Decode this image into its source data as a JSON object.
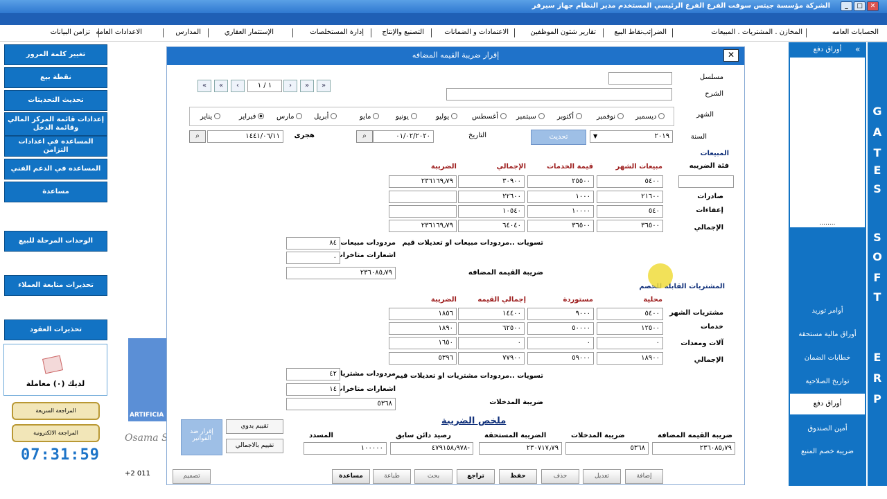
{
  "window": {
    "title": "الشركة مؤسسة جيتس سوفت   الفرع الفرع الرئيسي   المستخدم مدير النظام   جهاز سيرفر",
    "minimize": "_",
    "maximize": "□",
    "close": "✕"
  },
  "menu": [
    "الحسابات العامه",
    "المخازن . المشتريات . المبيعات",
    "الضرائب",
    "نقاط البيع",
    "تقارير شئون الموظفين",
    "الاعتمادات و الضمانات",
    "التصنيع والإنتاج",
    "إدارة المستخلصات",
    "الإستثمار العقاري",
    "المدارس",
    "الاعدادات العامه",
    "تزامن البيانات"
  ],
  "left_buttons": [
    "تغيير كلمة المرور",
    "نقطة بيع",
    "تحديث التحديثات",
    "إعدادات قائمة المركز المالي وقائمة الدخل",
    "المساعده في اعدادات التزامن",
    "المساعده في الدعم الفني",
    "مساعدة",
    "الوحدات المرحلة للبيع",
    "تحذيرات متابعة العملاء",
    "تحذيرات العقود"
  ],
  "notification": "لديك (٠) معاملة",
  "gold_buttons": [
    "المراجعة السريعة",
    "المراجعة الالكترونية"
  ],
  "clock": "07:31:59",
  "footer": {
    "phone": "+2 011",
    "company": "Osama S",
    "brand": "ARTIFICIA"
  },
  "dialog": {
    "title": "إقرار ضريبة القيمه المضافه",
    "close": "✕",
    "labels": {
      "serial": "مسلسل",
      "desc": "الشرح",
      "month": "الشهر",
      "year": "السنة",
      "date": "التاريخ",
      "hijri": "هجرى",
      "update": "تحديث",
      "category": "فئة الضريبه"
    },
    "values": {
      "year": "٢٠١٩",
      "date": "٠١/٠٢/٢٠٢٠",
      "hijri": "١٤٤١/٠٦/١١",
      "nav": "١ / ١"
    },
    "months": [
      "ديسمبر",
      "نوفمبر",
      "أكتوبر",
      "سبتمبر",
      "أغسطس",
      "يوليو",
      "يونيو",
      "مايو",
      "أبريل",
      "مارس",
      "فبراير",
      "يناير"
    ],
    "selected_month": "فبراير",
    "sales": {
      "title": "المبيعات",
      "headers": [
        "مبيعات الشهر",
        "قيمة الخدمات",
        "الإجمالي",
        "الضريبة"
      ],
      "row_labels": [
        "صادرات",
        "إعفاءات",
        "الإجمالي"
      ],
      "rows": [
        [
          "٥٤٠٠",
          "٢٥٥٠٠",
          "٣٠٩٠٠",
          "٢٣٦١٦٩٫٧٩"
        ],
        [
          "٢١٦٠٠",
          "١٠٠٠",
          "٢٢٦٠٠",
          ""
        ],
        [
          "٥٤٠",
          "١٠٠٠٠",
          "١٠٥٤٠",
          ""
        ],
        [
          "٣٦٥٠٠",
          "٣٦٥٠٠",
          "٦٤٠٤٠",
          "٢٣٦١٦٩٫٧٩"
        ]
      ],
      "adj_label": "تسويات ..مردودات مبيعات او تعديلات قيم",
      "returns_label": "مردودات مبيعات",
      "returns": "٨٤",
      "late_label": "اشعارات متاخرات",
      "late": "٠",
      "vat_label": "ضريبة القيمه المضافه",
      "vat": "٢٣٦٠٨٥٫٧٩"
    },
    "purchases": {
      "title": "المشتريات القابلة للخصم",
      "headers": [
        "محلية",
        "مستوردة",
        "إجمالي القيمه",
        "الضريبة"
      ],
      "row_labels": [
        "مشتريات الشهر",
        "خدمات",
        "آلات ومعدات",
        "الإجمالي"
      ],
      "rows": [
        [
          "٥٤٠٠",
          "٩٠٠٠",
          "١٤٤٠٠",
          "١٨٥٦"
        ],
        [
          "١٢٥٠٠",
          "٥٠٠٠٠",
          "٦٢٥٠٠",
          "١٨٩٠"
        ],
        [
          "٠",
          "٠",
          "٠",
          "١٦٥٠"
        ],
        [
          "١٨٩٠٠",
          "٥٩٠٠٠",
          "٧٧٩٠٠",
          "٥٣٩٦"
        ]
      ],
      "adj_label": "تسويات ..مردودات مشتريات او تعديلات قيم",
      "returns_label": "مردودات مشتريات",
      "returns": "٤٢",
      "late_label": "اشعارات متاخرات",
      "late": "١٤",
      "tax_label": "ضريبة المدخلات",
      "tax": "٥٣٦٨"
    },
    "summary": {
      "title": "ملخص الضريبة",
      "headers": [
        "ضريبة القيمه المضافة",
        "ضريبة المدخلات",
        "الضريبة المستحقة",
        "رصيد دائن سابق",
        "المسدد"
      ],
      "values": [
        "٢٣٦٠٨٥٫٧٩",
        "٥٣٦٨",
        "٢٣٠٧١٧٫٧٩",
        "٤٧٩١٥٨٫٩٧٨-",
        "١٠٠٠٠٠"
      ]
    },
    "side_buttons": {
      "invoice": "إقرار ضد الفواتير",
      "manual": "تقييم يدوي",
      "auto": "تقييم بالاجمالي"
    },
    "bottom_buttons": [
      "إضافة",
      "تعديل",
      "حذف",
      "حفظ",
      "تراجع",
      "بحث",
      "طباعة",
      "مساعدة"
    ],
    "print_label": "تصميم"
  },
  "right_panel": {
    "top": "أوراق دفع",
    "dots": "........",
    "items": [
      "أوامر توريد",
      "أوراق مالية مستحقة",
      "خطابات الضمان",
      "تواريخ الصلاحية",
      "أوراق دفع",
      "أمين الصندوق",
      "ضريبة خصم المنبع"
    ],
    "active": "أوراق دفع"
  },
  "vertical_text": [
    "G",
    "A",
    "T",
    "E",
    "S",
    "S",
    "O",
    "F",
    "T",
    "E",
    "R",
    "P"
  ]
}
